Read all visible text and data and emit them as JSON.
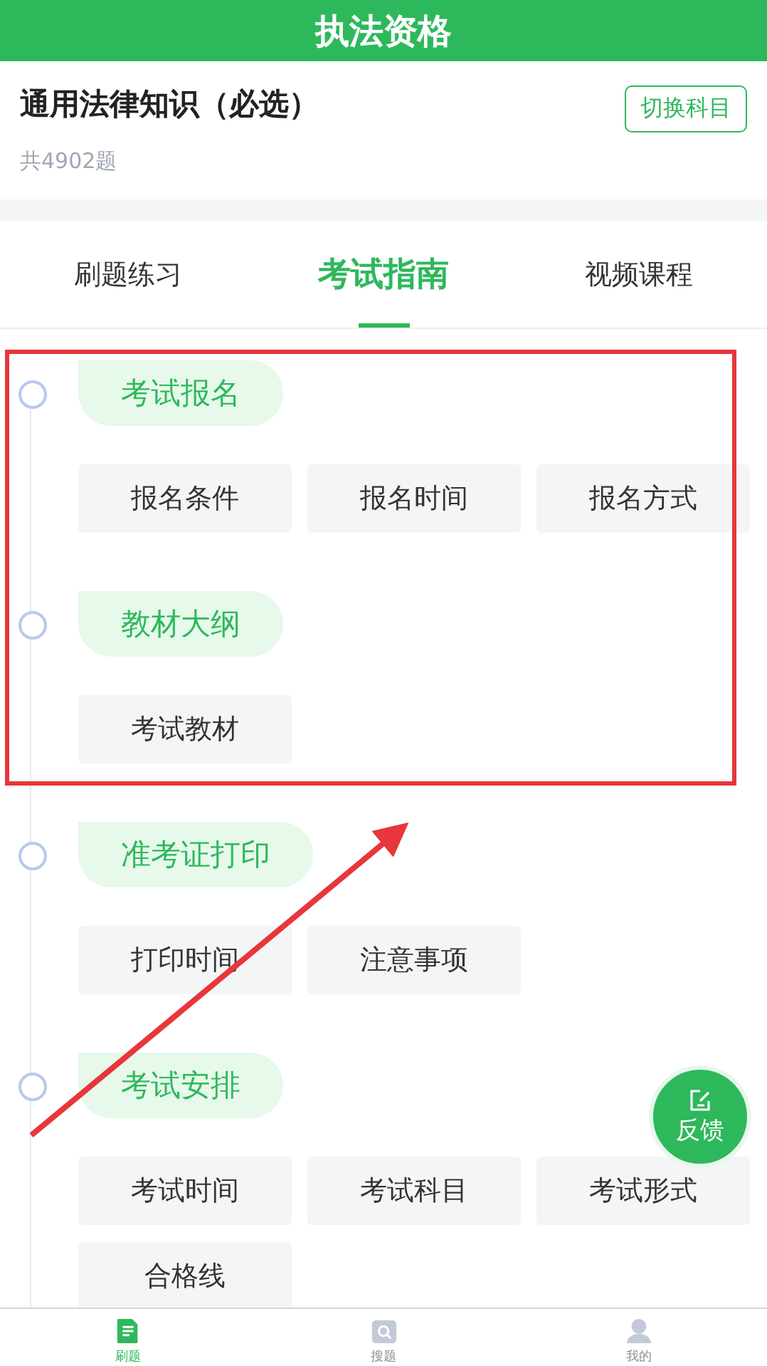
{
  "header": {
    "title": "执法资格"
  },
  "subject": {
    "name": "通用法律知识（必选）",
    "count": "共4902题",
    "switch_button": "切换科目"
  },
  "tabs": [
    {
      "label": "刷题练习",
      "selected": false
    },
    {
      "label": "考试指南",
      "selected": true
    },
    {
      "label": "视频课程",
      "selected": false
    }
  ],
  "sections": [
    {
      "title": "考试报名",
      "items": [
        "报名条件",
        "报名时间",
        "报名方式"
      ]
    },
    {
      "title": "教材大纲",
      "items": [
        "考试教材"
      ]
    },
    {
      "title": "准考证打印",
      "items": [
        "打印时间",
        "注意事项"
      ]
    },
    {
      "title": "考试安排",
      "items": [
        "考试时间",
        "考试科目",
        "考试形式",
        "合格线"
      ]
    }
  ],
  "feedback_button": "反馈",
  "bottom_nav": [
    {
      "label": "刷题",
      "selected": true,
      "kind": "practice"
    },
    {
      "label": "搜题",
      "selected": false,
      "kind": "search"
    },
    {
      "label": "我的",
      "selected": false,
      "kind": "profile"
    }
  ]
}
